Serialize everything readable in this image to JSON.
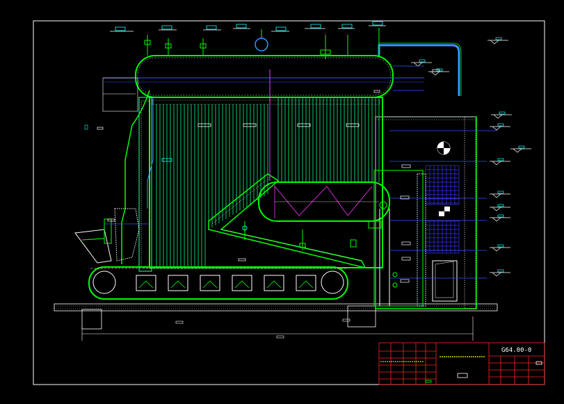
{
  "drawing": {
    "drawing_number": "G64.00-0",
    "title_caption": "",
    "colors": {
      "background": "#000000",
      "frame": "#ffffff",
      "boiler": "#00ff00",
      "tubes": "#00cc66",
      "water_wall": "#33ff99",
      "grid": "#3333ff",
      "dimension": "#ffffff",
      "pipe_magenta": "#ff33ff",
      "title_block": "#ff2222",
      "accent_cyan": "#00ffff",
      "yellow": "#ffff00"
    },
    "icons": [
      "valve-icon",
      "level-marker-icon",
      "section-cut-icon",
      "fan-icon"
    ]
  }
}
